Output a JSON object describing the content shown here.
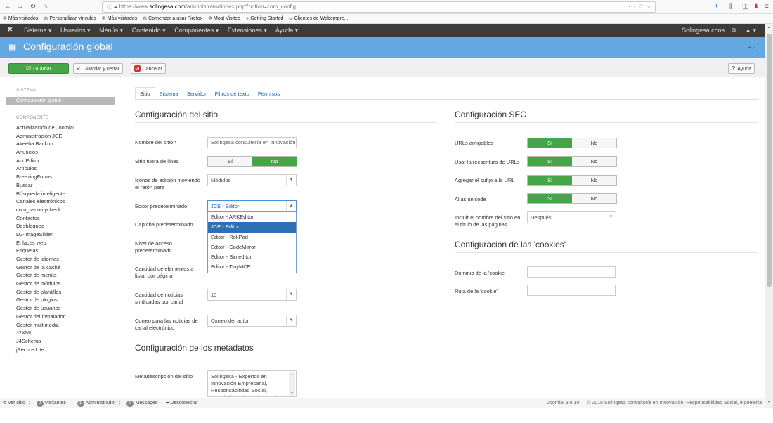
{
  "browser": {
    "url_prefix": "https://www.",
    "url_domain": "solingesa.com",
    "url_path": "/administrator/index.php?option=com_config",
    "url_more": "··· ♡ ☆",
    "bookmarks": [
      "Más visitados",
      "Personalizar vínculos",
      "Más visitados",
      "Comenzar a usar Firefox",
      "Most Visited",
      "Getting Started",
      "Clientes de Webempre..."
    ]
  },
  "topnav": {
    "menu": [
      "Sistema ▾",
      "Usuarios ▾",
      "Menús ▾",
      "Contenido ▾",
      "Componentes ▾",
      "Extensiones ▾",
      "Ayuda ▾"
    ],
    "site": "Solingesa cons... ⧉",
    "user": "▲ ▾"
  },
  "header": {
    "title": "Configuración global"
  },
  "toolbar": {
    "save": "Guardar",
    "save_close": "Guardar y cerrar",
    "cancel": "Cancelar",
    "help": "Ayuda"
  },
  "sidebar": {
    "system_head": "SISTEMA",
    "active": "Configuración global",
    "component_head": "COMPONENTE",
    "items": [
      "Actualización de Joomla!",
      "Administración JCE",
      "Akeeba Backup",
      "Anuncios",
      "Ark Editor",
      "Artículos",
      "BreezingForms",
      "Buscar",
      "Búsqueda inteligente",
      "Canales electrónicos",
      "com_securitycheck",
      "Contactos",
      "Desbloqueo",
      "DJ-ImageSlider",
      "Enlaces web",
      "Etiquetas",
      "Gestor de idiomas",
      "Gestor de la caché",
      "Gestor de menús",
      "Gestor de módulos",
      "Gestor de plantillas",
      "Gestor de plugins",
      "Gestor de usuarios",
      "Gestor del instalador",
      "Gestor multimedia",
      "J2XML",
      "J4Schema",
      "jSecure Lite"
    ]
  },
  "tabs": [
    "Sitio",
    "Sistema",
    "Servidor",
    "Filtros de texto",
    "Permisos"
  ],
  "site": {
    "title": "Configuración del sitio",
    "name_label": "Nombre del sitio *",
    "name_value": "Solingesa consultoría en Innovación",
    "offline_label": "Sitio fuera de línea",
    "offline_yes": "Sí",
    "offline_no": "No",
    "icons_label": "Iconos de edición moviendo el ratón para",
    "icons_value": "Módulos",
    "editor_label": "Editor predeterminado",
    "editor_value": "JCE - Editor",
    "editor_options": [
      "Editor - ARKEditor",
      "JCE - Editor",
      "Editor - RokPad",
      "Editor - CodeMirror",
      "Editor - Sin editor",
      "Editor - TinyMCE"
    ],
    "captcha_label": "Captcha predeterminado",
    "access_label": "Nivel de acceso predeterminado",
    "list_label": "Cantidad de elementos a listar por página",
    "feed_label": "Cantidad de noticias sindicadas por canal",
    "feed_value": "10",
    "email_label": "Correo para las noticias de canal electrónico",
    "email_value": "Correo del autor"
  },
  "metadata": {
    "title": "Configuración de los metadatos",
    "desc_label": "Metadescripción del sitio",
    "desc_value": "Solingesa - Expertos en Innovación Empresarial, Responsabilidad Social, Ingeniería Ambiental, Ingeniería"
  },
  "seo": {
    "title": "Configuración SEO",
    "friendly_label": "URLs amigables",
    "rewrite_label": "Usar la reescritura de URLs",
    "suffix_label": "Agregar el sufijo a la URL",
    "unicode_label": "Alias unicode",
    "yes": "Sí",
    "no": "No",
    "sitename_label": "Incluir el nombre del sitio en el título de las páginas",
    "sitename_value": "Después"
  },
  "cookies": {
    "title": "Configuración de las 'cookies'",
    "domain_label": "Dominio de la 'cookie'",
    "path_label": "Ruta de la 'cookie'"
  },
  "status": {
    "view_site": "Ver sitio",
    "visitors_count": "0",
    "visitors": "Visitantes",
    "admin_count": "1",
    "admin": "Administrador",
    "messages_count": "0",
    "messages": "Messages",
    "logout": "Desconectar",
    "footer": "Joomla! 3.8.10 — © 2018 Solingesa consultoría en Innovación, Responsabilidad Social, Ingeniería"
  },
  "colors": {
    "accent_green": "#46a546",
    "header_blue": "#63a8e0",
    "topnav": "#3b3b3b",
    "link_blue": "#1a67b5"
  }
}
